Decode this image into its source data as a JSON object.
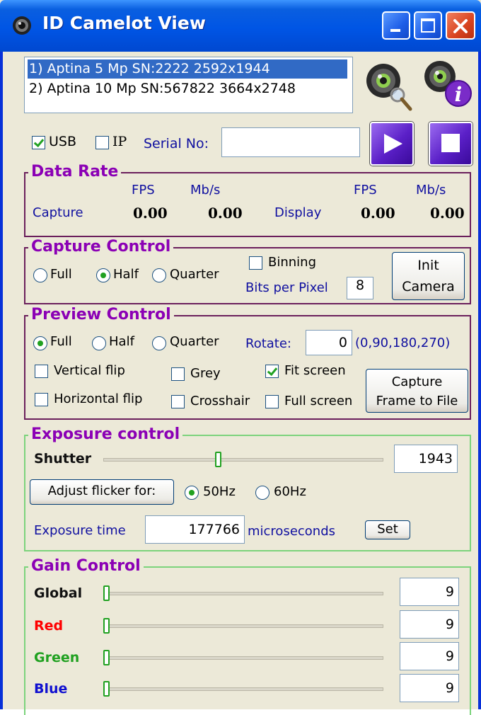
{
  "window": {
    "title": "ID Camelot View"
  },
  "camera_list": {
    "items": [
      "1) Aptina 5 Mp SN:2222  2592x1944",
      "2) Aptina 10 Mp SN:567822  3664x2748"
    ],
    "selected_index": 0
  },
  "connection": {
    "usb_label": "USB",
    "usb_checked": true,
    "ip_label": "IP",
    "ip_checked": false,
    "serial_label": "Serial No:",
    "serial_value": ""
  },
  "data_rate": {
    "title": "Data Rate",
    "fps_header": "FPS",
    "mbs_header": "Mb/s",
    "capture_label": "Capture",
    "capture_fps": "0.00",
    "capture_mbs": "0.00",
    "display_label": "Display",
    "display_fps": "0.00",
    "display_mbs": "0.00"
  },
  "capture_control": {
    "title": "Capture Control",
    "full": "Full",
    "half": "Half",
    "quarter": "Quarter",
    "selected": "Half",
    "binning_label": "Binning",
    "binning_checked": false,
    "bits_label": "Bits per Pixel",
    "bits_value": "8",
    "init_line1": "Init",
    "init_line2": "Camera"
  },
  "preview_control": {
    "title": "Preview Control",
    "full": "Full",
    "half": "Half",
    "quarter": "Quarter",
    "selected": "Full",
    "rotate_label": "Rotate:",
    "rotate_value": "0",
    "rotate_hint": "(0,90,180,270)",
    "vertical_flip": "Vertical flip",
    "horizontal_flip": "Horizontal flip",
    "grey": "Grey",
    "crosshair": "Crosshair",
    "fit_screen": "Fit screen",
    "fit_screen_checked": true,
    "full_screen": "Full screen",
    "capture_line1": "Capture",
    "capture_line2": "Frame to File"
  },
  "exposure_control": {
    "title": "Exposure control",
    "shutter_label": "Shutter",
    "shutter_value": "1943",
    "shutter_fraction": 0.4,
    "flicker_button": "Adjust flicker for:",
    "hz50": "50Hz",
    "hz60": "60Hz",
    "selected_hz": "50Hz",
    "exposure_label": "Exposure time",
    "exposure_value": "177766",
    "exposure_unit": "microseconds",
    "set_button": "Set"
  },
  "gain_control": {
    "title": "Gain Control",
    "global_label": "Global",
    "global_value": "9",
    "red_label": "Red",
    "red_value": "9",
    "green_label": "Green",
    "green_value": "9",
    "blue_label": "Blue",
    "blue_value": "9",
    "colors": {
      "global": "#000000",
      "red": "#FF0000",
      "green": "#21A121",
      "blue": "#1010D0"
    }
  },
  "colors": {
    "title_bar": "#0055E5",
    "group_title": "#8B00B5",
    "face": "#ECE9D8"
  }
}
